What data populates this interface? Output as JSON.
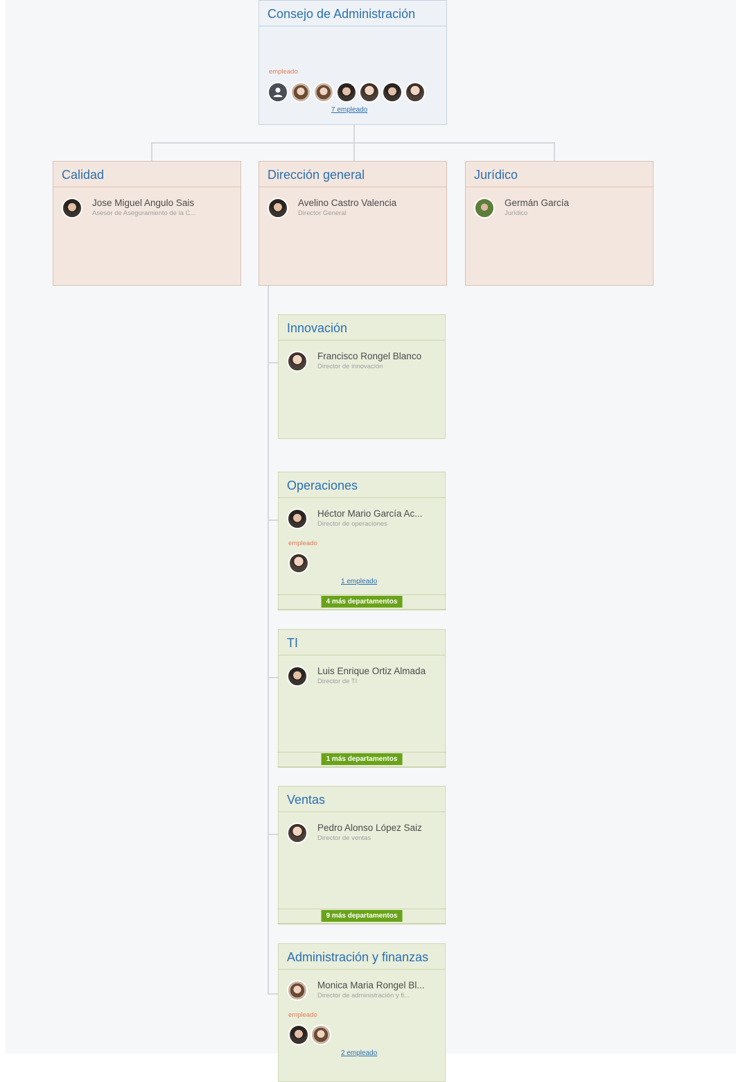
{
  "board": {
    "title": "Consejo de Administración",
    "employees_label": "empleado",
    "employees_link": "7 empleado",
    "member_avatars": [
      "user-icon",
      "avatar-woman",
      "avatar-woman",
      "avatar-man",
      "avatar-man",
      "avatar-man",
      "avatar-man"
    ]
  },
  "departments": {
    "calidad": {
      "title": "Calidad",
      "head_name": "Jose Miguel Angulo Sais",
      "head_position": "Asesor de Aseguramiento de la C..."
    },
    "direccion": {
      "title": "Dirección general",
      "head_name": "Avelino Castro Valencia",
      "head_position": "Director General"
    },
    "juridico": {
      "title": "Jurídico",
      "head_name": "Germán García",
      "head_position": "Jurídico"
    },
    "innovacion": {
      "title": "Innovación",
      "head_name": "Francisco Rongel Blanco",
      "head_position": "Director de innovación"
    },
    "operaciones": {
      "title": "Operaciones",
      "head_name": "Héctor Mario García Ac...",
      "head_position": "Director de operaciones",
      "employees_label": "empleado",
      "employees_link": "1 empleado",
      "more_label": "4 más departamentos"
    },
    "ti": {
      "title": "TI",
      "head_name": "Luis Enrique Ortiz Almada",
      "head_position": "Director de TI",
      "more_label": "1 más departamentos"
    },
    "ventas": {
      "title": "Ventas",
      "head_name": "Pedro Alonso López Saiz",
      "head_position": "Director de ventas",
      "more_label": "9 más departamentos"
    },
    "admin": {
      "title": "Administración y finanzas",
      "head_name": "Monica Maria Rongel Bl...",
      "head_position": "Director de administración y fi...",
      "employees_label": "empleado",
      "employees_link": "2 empleado"
    }
  },
  "colors": {
    "title_blue": "#2b6fb1",
    "top_card": "#eef2f6",
    "peach_card": "#f3e6de",
    "green_card": "#e9eedb",
    "more_button": "#6aa31a",
    "employee_label": "#e07a52"
  }
}
